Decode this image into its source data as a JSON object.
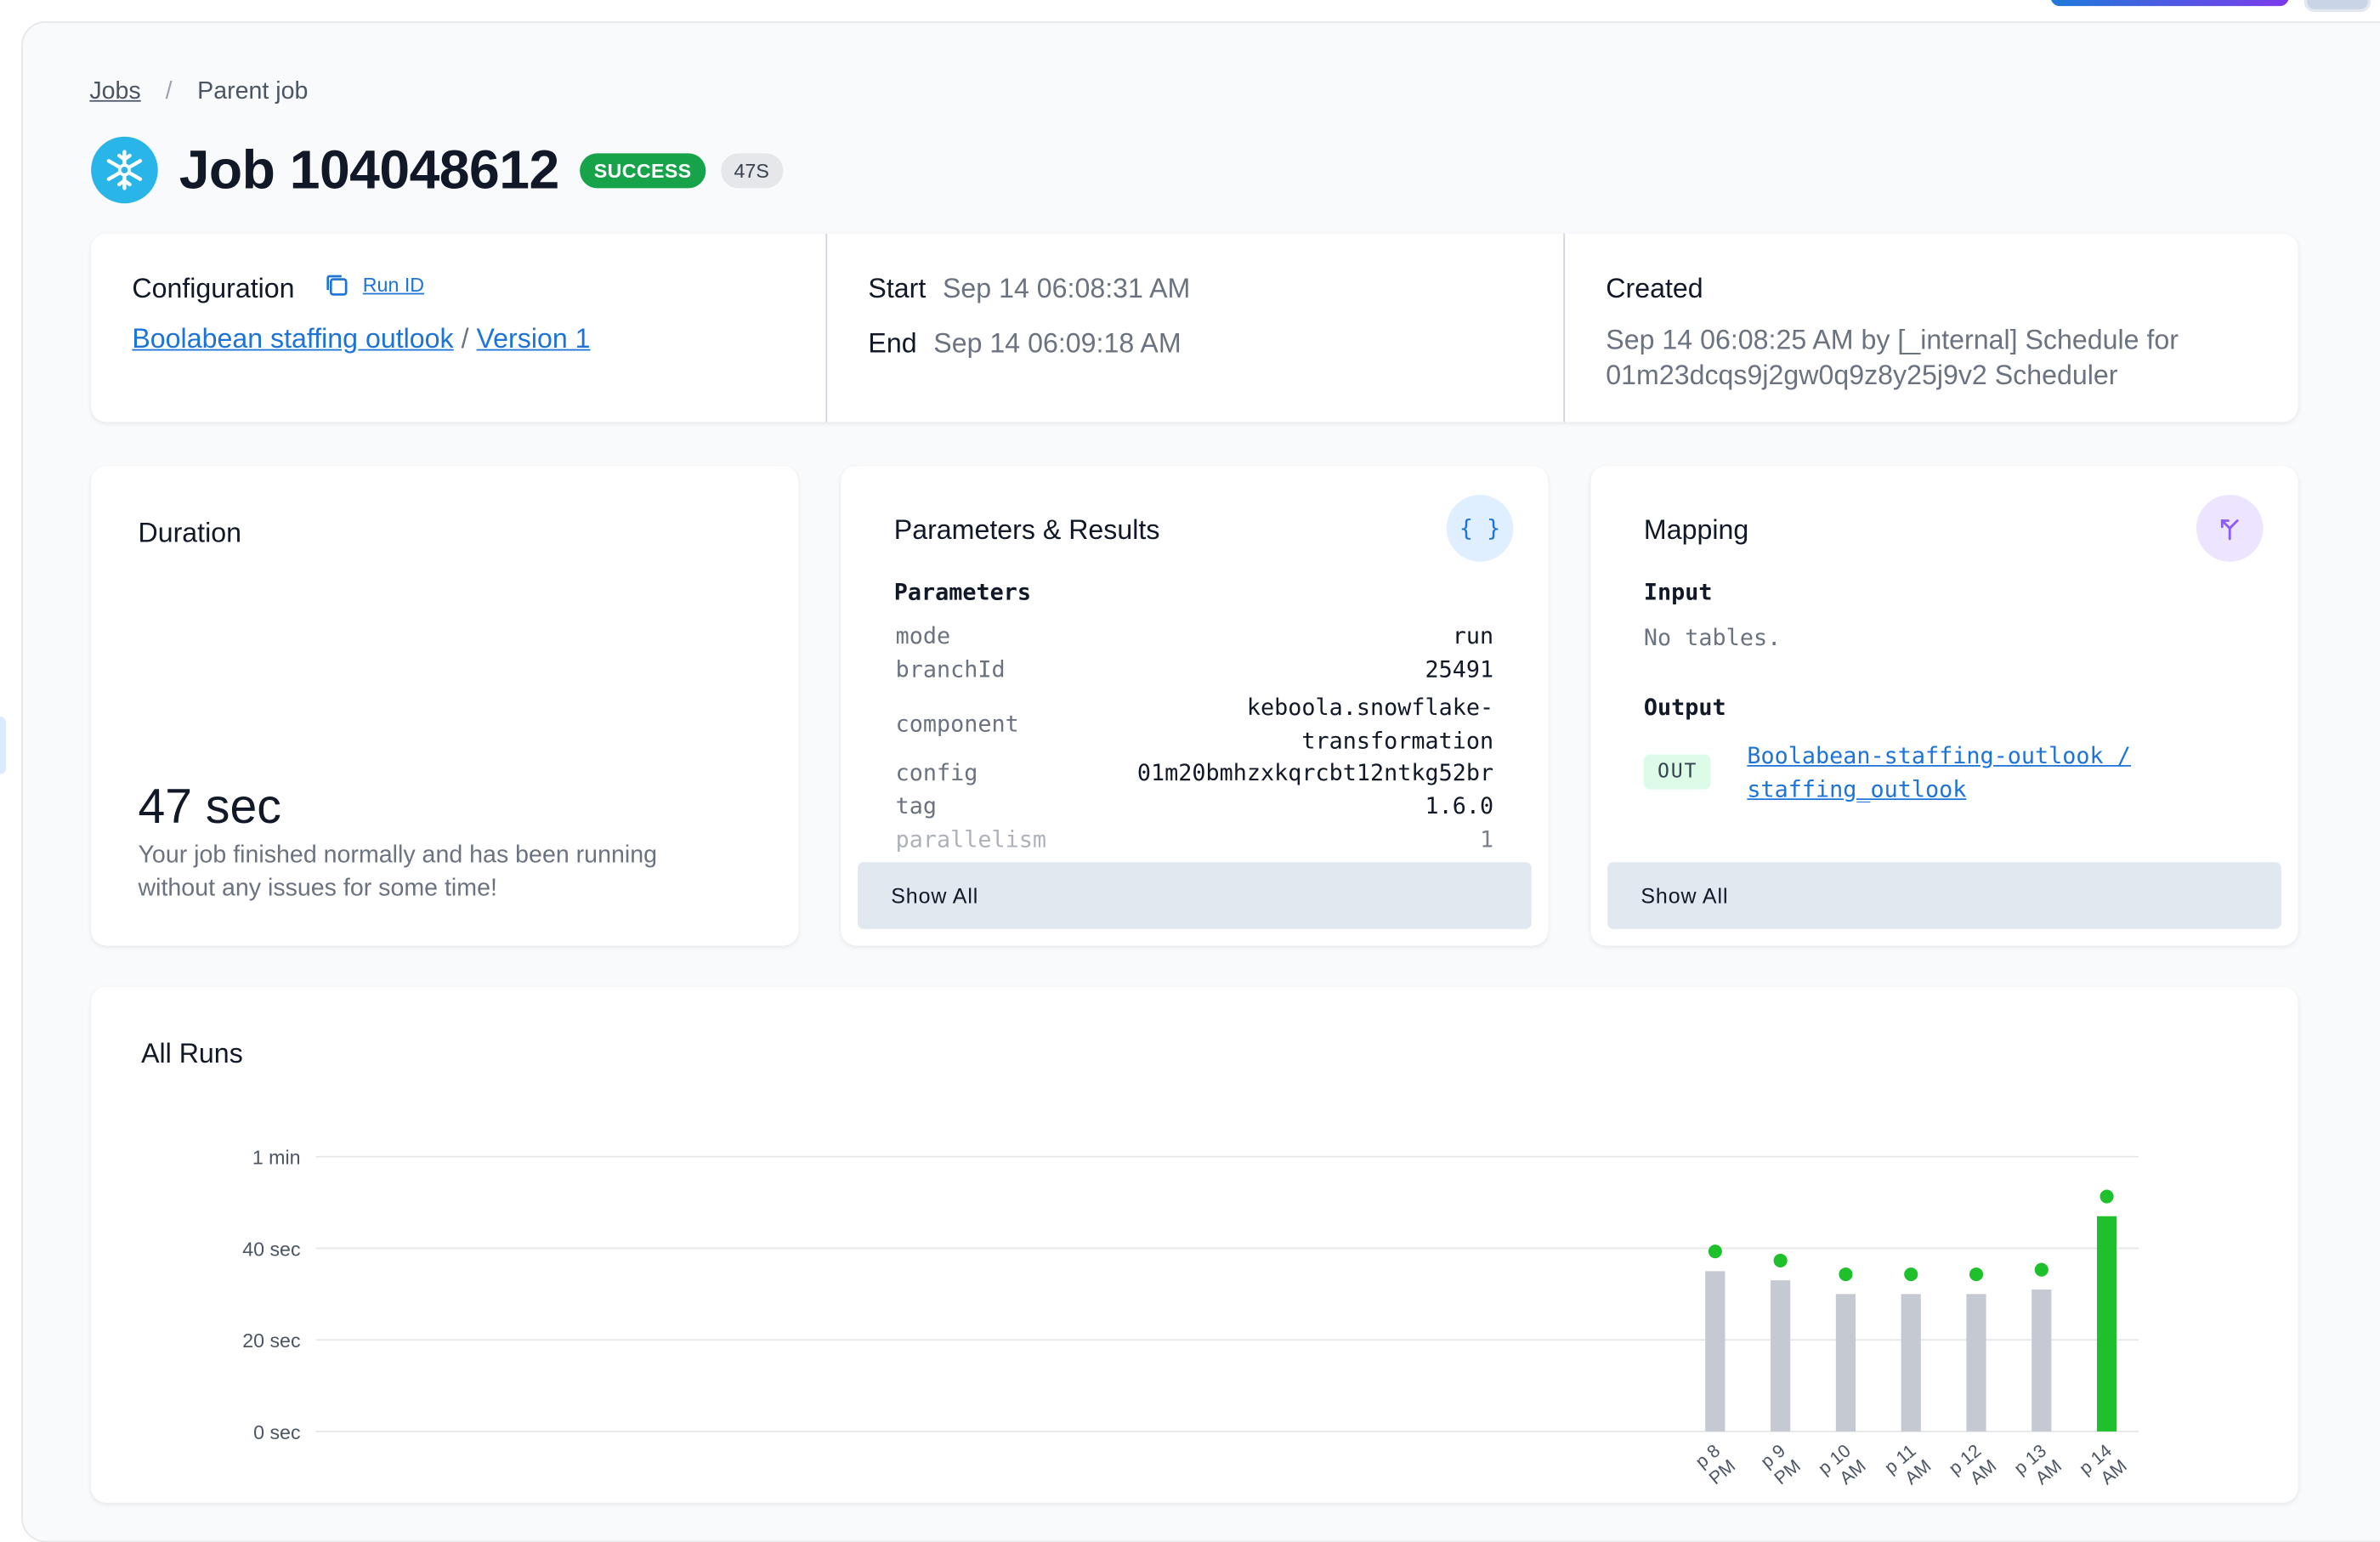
{
  "breadcrumb": {
    "jobs": "Jobs",
    "separator": "/",
    "parent": "Parent job"
  },
  "job": {
    "title": "Job 104048612",
    "status": "SUCCESS",
    "duration_badge": "47S"
  },
  "colors": {
    "success": "#16a34a",
    "link": "#1d74d8",
    "bar_past": "#c4c9d2",
    "bar_current": "#1ec02c"
  },
  "info": {
    "configuration_label": "Configuration",
    "run_id_label": "Run ID",
    "config_name": "Boolabean staffing outlook",
    "config_sep": "/",
    "version": "Version 1",
    "start_label": "Start",
    "start_value": "Sep 14 06:08:31 AM",
    "end_label": "End",
    "end_value": "Sep 14 06:09:18 AM",
    "created_label": "Created",
    "created_line1": "Sep 14 06:08:25 AM by [_internal] Schedule for",
    "created_line2": "01m23dcqs9j2gw0q9z8y25j9v2 Scheduler"
  },
  "duration": {
    "title": "Duration",
    "value": "47 sec",
    "desc_line1": "Your job finished normally and has been running",
    "desc_line2": "without any issues for some time!"
  },
  "params": {
    "title": "Parameters & Results",
    "icon": "braces-icon",
    "section": "Parameters",
    "rows": [
      {
        "key": "mode",
        "value": "run"
      },
      {
        "key": "branchId",
        "value": "25491"
      },
      {
        "key": "component",
        "value1": "keboola.snowflake-",
        "value2": "transformation"
      },
      {
        "key": "config",
        "value": "01m20bmhzxkqrcbt12ntkg52br"
      },
      {
        "key": "tag",
        "value": "1.6.0"
      },
      {
        "key": "parallelism",
        "value": "1"
      }
    ],
    "show_all": "Show All"
  },
  "mapping": {
    "title": "Mapping",
    "icon": "branch-icon",
    "input_label": "Input",
    "input_value": "No tables.",
    "output_label": "Output",
    "out_badge": "OUT",
    "output_line1": "Boolabean-staffing-outlook /",
    "output_line2": "staffing_outlook",
    "show_all": "Show All"
  },
  "chart_data": {
    "type": "bar",
    "title": "All Runs",
    "y_ticks": [
      "1 min",
      "40 sec",
      "20 sec",
      "0 sec"
    ],
    "ylim": [
      0,
      60
    ],
    "categories": [
      "Sep 8",
      "Sep 9",
      "Sep 10",
      "Sep 11",
      "Sep 12",
      "Sep 13",
      "Sep 14"
    ],
    "x_tick_labels": [
      {
        "top": "p 8",
        "bottom": "PM"
      },
      {
        "top": "p 9",
        "bottom": "PM"
      },
      {
        "top": "p 10",
        "bottom": "AM"
      },
      {
        "top": "p 11",
        "bottom": "AM"
      },
      {
        "top": "p 12",
        "bottom": "AM"
      },
      {
        "top": "p 13",
        "bottom": "AM"
      },
      {
        "top": "p 14",
        "bottom": "AM"
      }
    ],
    "values": [
      35,
      33,
      30,
      30,
      30,
      31,
      47
    ],
    "current_index": 6
  }
}
